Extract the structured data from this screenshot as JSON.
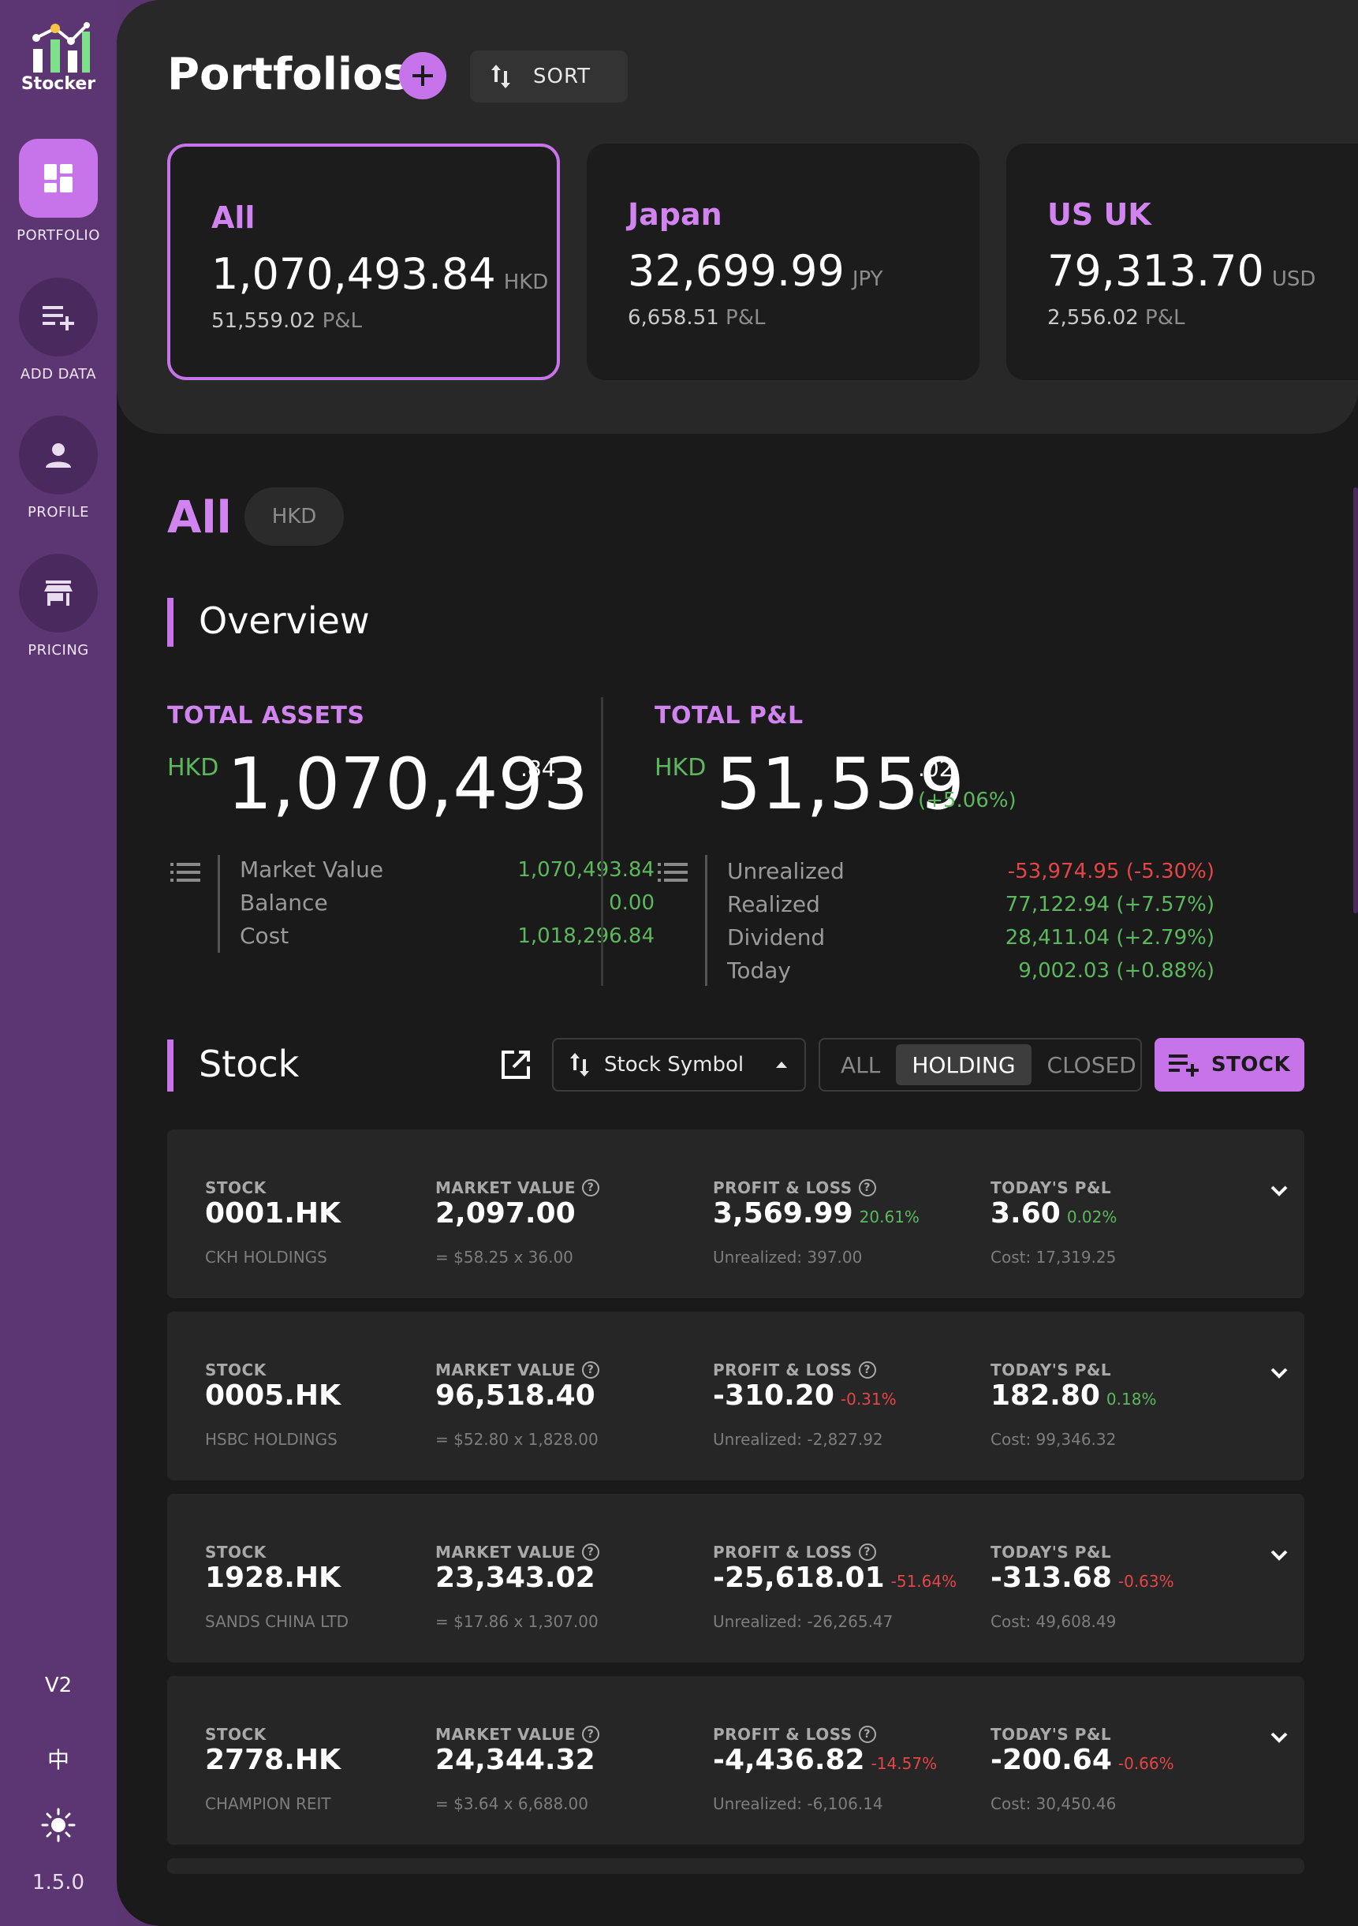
{
  "app": {
    "name": "Stocker",
    "version": "1.5.0",
    "ui_version": "V2",
    "lang_toggle": "中"
  },
  "sidebar": {
    "items": [
      {
        "label": "PORTFOLIO",
        "icon": "dashboard-icon",
        "active": true
      },
      {
        "label": "ADD DATA",
        "icon": "playlist-add-icon"
      },
      {
        "label": "PROFILE",
        "icon": "person-icon"
      },
      {
        "label": "PRICING",
        "icon": "store-icon"
      }
    ]
  },
  "header": {
    "title": "Portfolios",
    "sort_label": "SORT"
  },
  "portfolios": [
    {
      "name": "All",
      "value": "1,070,493.84",
      "currency": "HKD",
      "pl": "51,559.02",
      "pl_label": "P&L"
    },
    {
      "name": "Japan",
      "value": "32,699.99",
      "currency": "JPY",
      "pl": "6,658.51",
      "pl_label": "P&L"
    },
    {
      "name": "US UK",
      "value": "79,313.70",
      "currency": "USD",
      "pl": "2,556.02",
      "pl_label": "P&L"
    }
  ],
  "selected": {
    "name": "All",
    "currency": "HKD"
  },
  "overview": {
    "title": "Overview",
    "total_assets": {
      "label": "TOTAL ASSETS",
      "currency": "HKD",
      "integer": "1,070,493",
      "decimal": ".84",
      "rows": [
        {
          "label": "Market Value",
          "value": "1,070,493.84"
        },
        {
          "label": "Balance",
          "value": "0.00"
        },
        {
          "label": "Cost",
          "value": "1,018,296.84"
        }
      ]
    },
    "total_pl": {
      "label": "TOTAL P&L",
      "currency": "HKD",
      "integer": "51,559",
      "decimal": ".02",
      "pct": "(+5.06%)",
      "rows": [
        {
          "label": "Unrealized",
          "value": "-53,974.95 (-5.30%)"
        },
        {
          "label": "Realized",
          "value": "77,122.94 (+7.57%)"
        },
        {
          "label": "Dividend",
          "value": "28,411.04 (+2.79%)"
        },
        {
          "label": "Today",
          "value": "9,002.03 (+0.88%)"
        }
      ]
    }
  },
  "stock": {
    "title": "Stock",
    "sort_field": "Stock Symbol",
    "filters": [
      "ALL",
      "HOLDING",
      "CLOSED"
    ],
    "active_filter": "HOLDING",
    "add_label": "STOCK",
    "columns": [
      "STOCK",
      "MARKET VALUE",
      "PROFIT & LOSS",
      "TODAY'S P&L"
    ],
    "rows": [
      {
        "symbol": "0001.HK",
        "name": "CKH HOLDINGS",
        "mv": "2,097.00",
        "mv_sub": "= $58.25 x 36.00",
        "pl": "3,569.99",
        "pl_pct": "20.61%",
        "pl_sub": "Unrealized: 397.00",
        "today": "3.60",
        "today_pct": "0.02%",
        "today_sub": "Cost: 17,319.25"
      },
      {
        "symbol": "0005.HK",
        "name": "HSBC HOLDINGS",
        "mv": "96,518.40",
        "mv_sub": "= $52.80 x 1,828.00",
        "pl": "-310.20",
        "pl_pct": "-0.31%",
        "pl_sub": "Unrealized: -2,827.92",
        "today": "182.80",
        "today_pct": "0.18%",
        "today_sub": "Cost: 99,346.32"
      },
      {
        "symbol": "1928.HK",
        "name": "SANDS CHINA LTD",
        "mv": "23,343.02",
        "mv_sub": "= $17.86 x 1,307.00",
        "pl": "-25,618.01",
        "pl_pct": "-51.64%",
        "pl_sub": "Unrealized: -26,265.47",
        "today": "-313.68",
        "today_pct": "-0.63%",
        "today_sub": "Cost: 49,608.49"
      },
      {
        "symbol": "2778.HK",
        "name": "CHAMPION REIT",
        "mv": "24,344.32",
        "mv_sub": "= $3.64 x 6,688.00",
        "pl": "-4,436.82",
        "pl_pct": "-14.57%",
        "pl_sub": "Unrealized: -6,106.14",
        "today": "-200.64",
        "today_pct": "-0.66%",
        "today_sub": "Cost: 30,450.46"
      }
    ]
  },
  "colors": {
    "accent": "#c774ea",
    "positive": "#5cb85c",
    "negative": "#e64545",
    "sidebar": "#5b3672"
  }
}
